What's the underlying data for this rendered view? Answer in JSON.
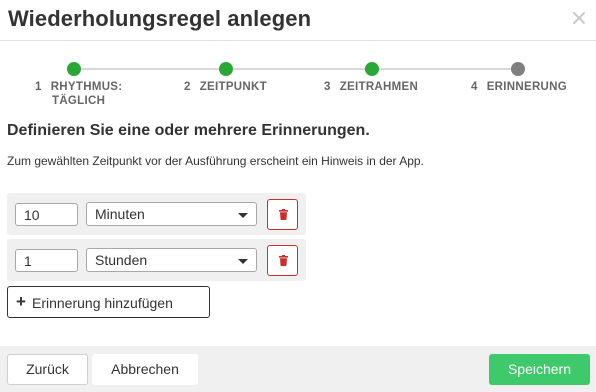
{
  "dialog": {
    "title": "Wiederholungsregel anlegen"
  },
  "steps": [
    {
      "number": "1",
      "label_line1": "RHYTHMUS:",
      "label_line2": "TÄGLICH",
      "status": "done"
    },
    {
      "number": "2",
      "label_line1": "ZEITPUNKT",
      "label_line2": "",
      "status": "done"
    },
    {
      "number": "3",
      "label_line1": "ZEITRAHMEN",
      "label_line2": "",
      "status": "done"
    },
    {
      "number": "4",
      "label_line1": "ERINNERUNG",
      "label_line2": "",
      "status": "current"
    }
  ],
  "content": {
    "heading": "Definieren Sie eine oder mehrere Erinnerungen.",
    "hint": "Zum gewählten Zeitpunkt vor der Ausführung erscheint ein Hinweis in der App."
  },
  "reminders": [
    {
      "value": "10",
      "unit": "Minuten"
    },
    {
      "value": "1",
      "unit": "Stunden"
    }
  ],
  "add_button": {
    "label": "Erinnerung hinzufügen"
  },
  "footer": {
    "back_label": "Zurück",
    "cancel_label": "Abbrechen",
    "save_label": "Speichern"
  },
  "colors": {
    "step_done": "#2aa837",
    "step_pending": "#808080",
    "save_button": "#3ec96a",
    "delete_border": "#c9302c"
  },
  "icons": {
    "close": "close-icon",
    "delete": "trash-icon",
    "add": "plus-icon",
    "dropdown": "caret-down-icon"
  }
}
